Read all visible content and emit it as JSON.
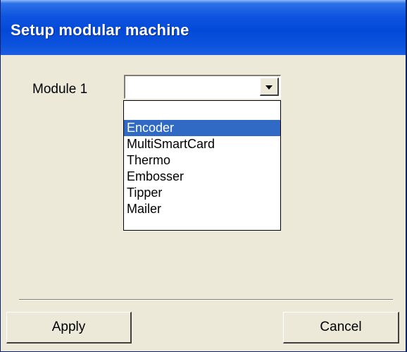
{
  "window": {
    "title": "Setup modular machine"
  },
  "form": {
    "module_label": "Module 1",
    "combo_value": ""
  },
  "dropdown": {
    "options": [
      "",
      "Encoder",
      "MultiSmartCard",
      "Thermo",
      "Embosser",
      "Tipper",
      "Mailer"
    ],
    "highlighted": "Encoder"
  },
  "buttons": {
    "apply_label": "Apply",
    "cancel_label": "Cancel"
  },
  "colors": {
    "titlebar": "#0349d8",
    "dialog_bg": "#ece9d8",
    "selection": "#316ac5"
  },
  "icons": {
    "combo_arrow": "chevron-down-icon"
  }
}
